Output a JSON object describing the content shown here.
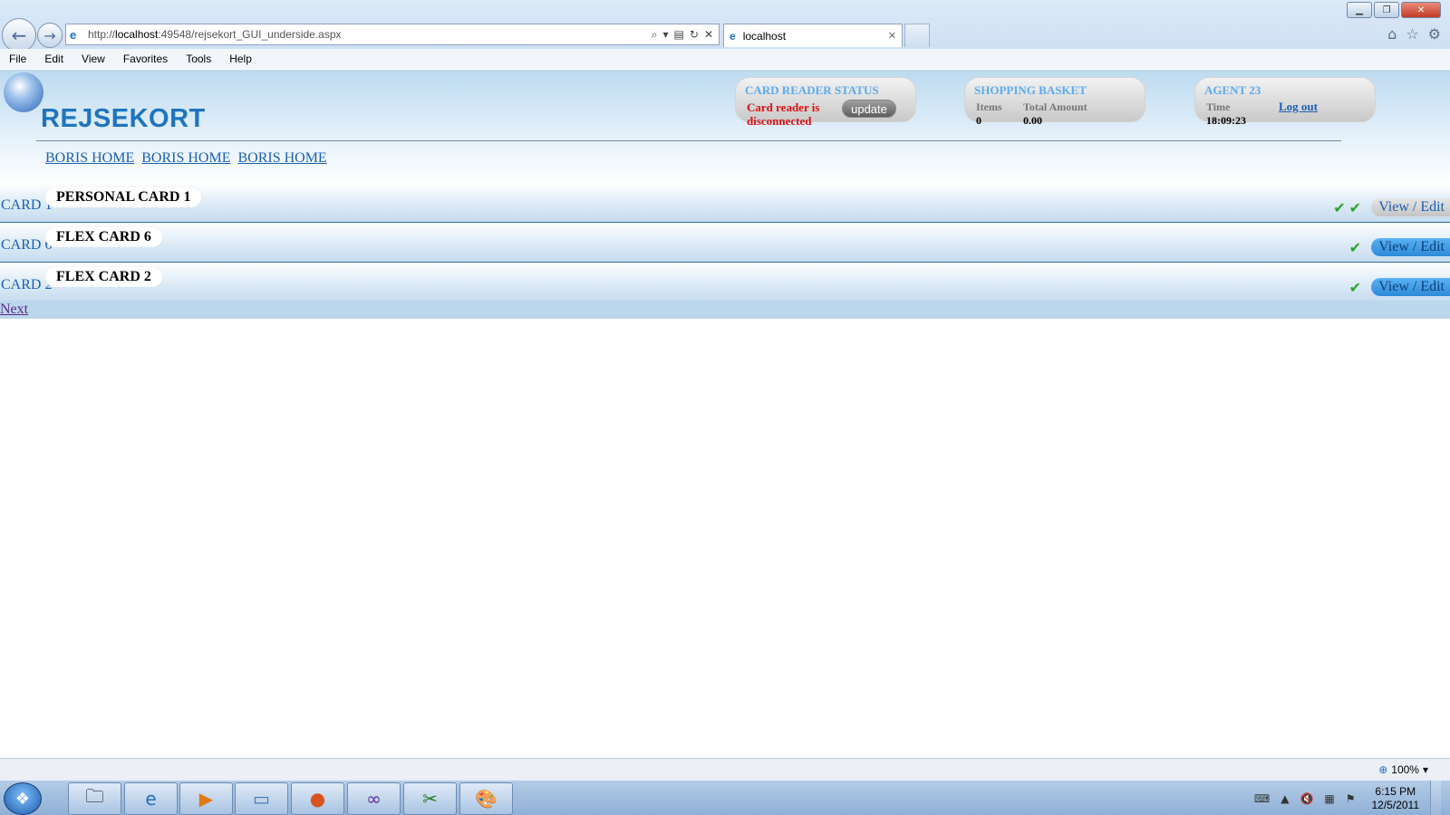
{
  "browser": {
    "url_prefix": "http://",
    "url_host": "localhost",
    "url_rest": ":49548/rejsekort_GUI_underside.aspx",
    "tab_title": "localhost",
    "menu": [
      "File",
      "Edit",
      "View",
      "Favorites",
      "Tools",
      "Help"
    ],
    "zoom": "100%"
  },
  "header": {
    "logo_text": "REJSEKORT",
    "card_reader": {
      "title": "CARD READER STATUS",
      "status": "Card reader is disconnected",
      "update_label": "update"
    },
    "basket": {
      "title": "SHOPPING BASKET",
      "items_label": "Items",
      "items_value": "0",
      "amount_label": "Total Amount",
      "amount_value": "0.00"
    },
    "agent": {
      "title": "AGENT 23",
      "time_label": "Time",
      "time_value": "18:09:23",
      "logout_label": "Log out"
    }
  },
  "nav_links": [
    "BORIS HOME",
    "BORIS HOME",
    "BORIS HOME"
  ],
  "cards": [
    {
      "code": "CARD 1",
      "name": "PERSONAL CARD 1",
      "checks": 2,
      "action": "View / Edit",
      "style": "grey"
    },
    {
      "code": "CARD 6",
      "name": "FLEX CARD 6",
      "checks": 1,
      "action": "View / Edit",
      "style": "blue"
    },
    {
      "code": "CARD 2",
      "name": "FLEX CARD 2",
      "checks": 1,
      "action": "View / Edit",
      "style": "blue"
    }
  ],
  "pager": {
    "next_label": "Next"
  },
  "taskbar": {
    "apps": [
      "explorer-icon",
      "ie-icon",
      "media-player-icon",
      "notepad-icon",
      "firefox-icon",
      "visual-studio-icon",
      "snipping-tool-icon",
      "paint-icon"
    ],
    "time": "6:15 PM",
    "date": "12/5/2011"
  }
}
